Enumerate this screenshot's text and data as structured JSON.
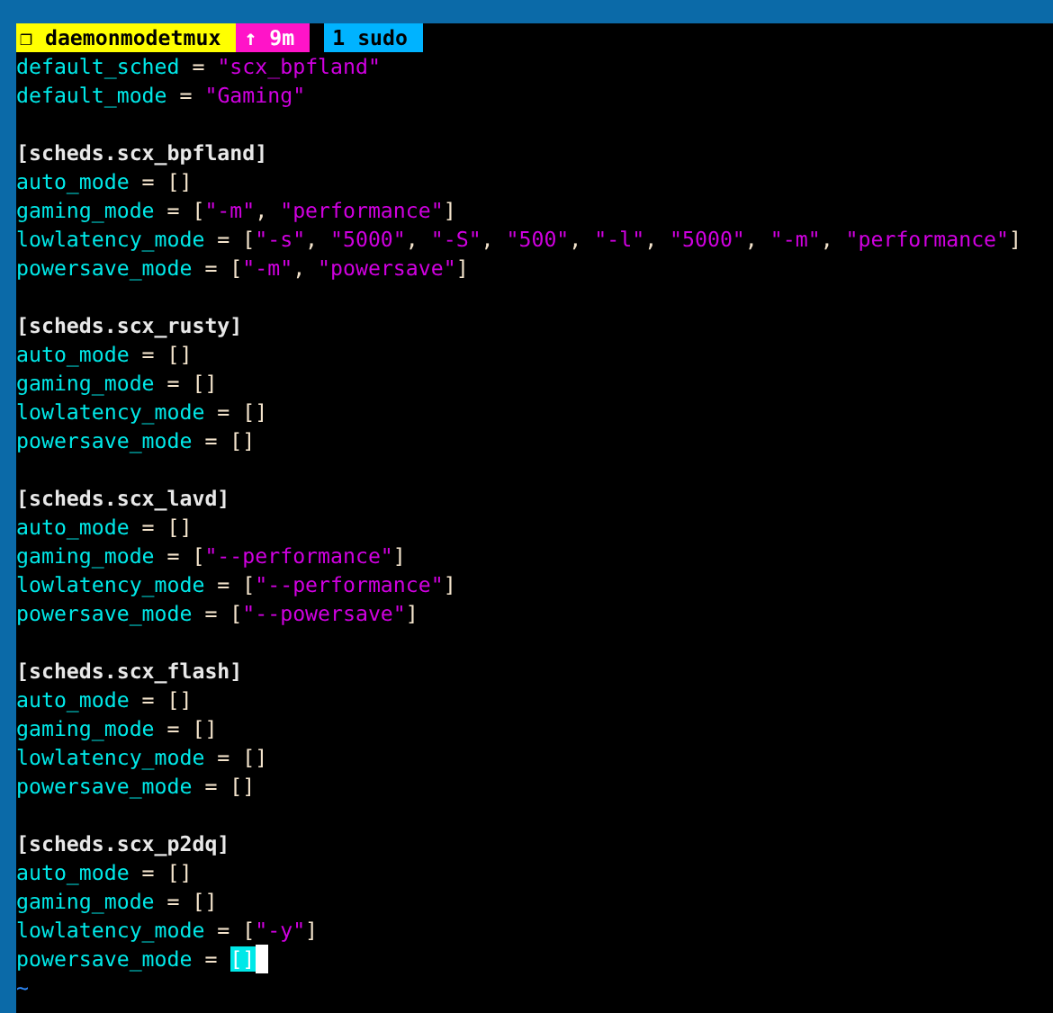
{
  "status_bar": {
    "session": "❐ daemonmodetmux",
    "uptime": "↑ 9m",
    "windows": [
      {
        "label": "1 sudo",
        "selected": true
      }
    ]
  },
  "editor": {
    "lines": [
      {
        "kind": "setting",
        "text": "default_sched = \"scx_bpfland\""
      },
      {
        "kind": "setting",
        "text": "default_mode = \"Gaming\""
      },
      {
        "kind": "blank"
      },
      {
        "kind": "section",
        "text": "[scheds.scx_bpfland]"
      },
      {
        "kind": "setting",
        "text": "auto_mode = []"
      },
      {
        "kind": "setting",
        "text": "gaming_mode = [\"-m\", \"performance\"]"
      },
      {
        "kind": "setting",
        "text": "lowlatency_mode = [\"-s\", \"5000\", \"-S\", \"500\", \"-l\", \"5000\", \"-m\", \"performance\"]"
      },
      {
        "kind": "setting",
        "text": "powersave_mode = [\"-m\", \"powersave\"]"
      },
      {
        "kind": "blank"
      },
      {
        "kind": "section",
        "text": "[scheds.scx_rusty]"
      },
      {
        "kind": "setting",
        "text": "auto_mode = []"
      },
      {
        "kind": "setting",
        "text": "gaming_mode = []"
      },
      {
        "kind": "setting",
        "text": "lowlatency_mode = []"
      },
      {
        "kind": "setting",
        "text": "powersave_mode = []"
      },
      {
        "kind": "blank"
      },
      {
        "kind": "section",
        "text": "[scheds.scx_lavd]"
      },
      {
        "kind": "setting",
        "text": "auto_mode = []"
      },
      {
        "kind": "setting",
        "text": "gaming_mode = [\"--performance\"]"
      },
      {
        "kind": "setting",
        "text": "lowlatency_mode = [\"--performance\"]"
      },
      {
        "kind": "setting",
        "text": "powersave_mode = [\"--powersave\"]"
      },
      {
        "kind": "blank"
      },
      {
        "kind": "section",
        "text": "[scheds.scx_flash]"
      },
      {
        "kind": "setting",
        "text": "auto_mode = []"
      },
      {
        "kind": "setting",
        "text": "gaming_mode = []"
      },
      {
        "kind": "setting",
        "text": "lowlatency_mode = []"
      },
      {
        "kind": "setting",
        "text": "powersave_mode = []"
      },
      {
        "kind": "blank"
      },
      {
        "kind": "section",
        "text": "[scheds.scx_p2dq]"
      },
      {
        "kind": "setting",
        "text": "auto_mode = []"
      },
      {
        "kind": "setting",
        "text": "gaming_mode = []"
      },
      {
        "kind": "setting",
        "text": "lowlatency_mode = [\"-y\"]"
      },
      {
        "kind": "setting",
        "text": "powersave_mode = []",
        "cursor": true
      },
      {
        "kind": "filler",
        "text": "~"
      }
    ]
  }
}
